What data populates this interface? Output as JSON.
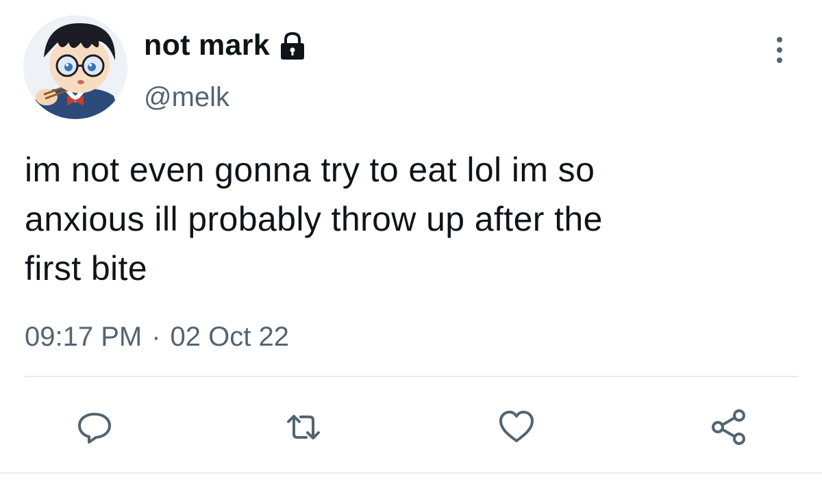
{
  "user": {
    "display_name": "not mark",
    "handle": "@melk",
    "avatar_icon": "avatar",
    "lock_icon": "lock-icon"
  },
  "tweet": {
    "text": "im not even gonna try to eat lol im so\nanxious ill probably throw up after the\nfirst bite",
    "time": "09:17 PM",
    "separator": "·",
    "date": "02 Oct 22"
  },
  "actions": [
    {
      "name": "reply",
      "icon": "reply-icon"
    },
    {
      "name": "retweet",
      "icon": "retweet-icon"
    },
    {
      "name": "like",
      "icon": "heart-icon"
    },
    {
      "name": "share",
      "icon": "share-icon"
    }
  ],
  "colors": {
    "text_primary": "#0f1419",
    "text_secondary": "#536471",
    "divider": "#e6e8ea",
    "icon": "#536471"
  }
}
